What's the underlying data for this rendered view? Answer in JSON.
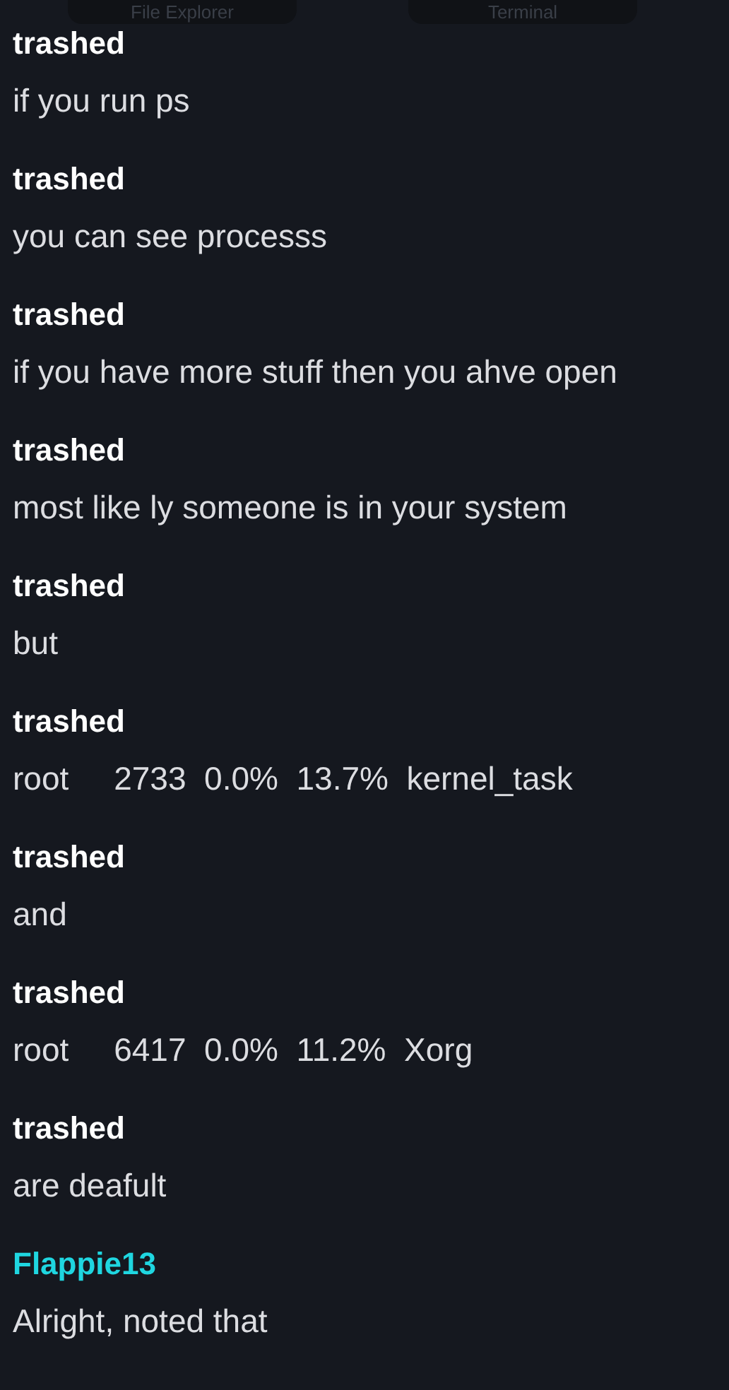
{
  "top_buttons": [
    {
      "label": "File Explorer"
    },
    {
      "label": "Terminal"
    }
  ],
  "messages": [
    {
      "author": "trashed",
      "highlighted": false,
      "text": "if you run ps"
    },
    {
      "author": "trashed",
      "highlighted": false,
      "text": "you can see processs"
    },
    {
      "author": "trashed",
      "highlighted": false,
      "text": "if you have more stuff then you ahve open"
    },
    {
      "author": "trashed",
      "highlighted": false,
      "text": "most like ly someone is in your system"
    },
    {
      "author": "trashed",
      "highlighted": false,
      "text": "but"
    },
    {
      "author": "trashed",
      "highlighted": false,
      "text": "root     2733  0.0%  13.7%  kernel_task"
    },
    {
      "author": "trashed",
      "highlighted": false,
      "text": "and"
    },
    {
      "author": "trashed",
      "highlighted": false,
      "text": "root     6417  0.0%  11.2%  Xorg"
    },
    {
      "author": "trashed",
      "highlighted": false,
      "text": "are deafult"
    },
    {
      "author": "Flappie13",
      "highlighted": true,
      "text": "Alright, noted that"
    }
  ]
}
